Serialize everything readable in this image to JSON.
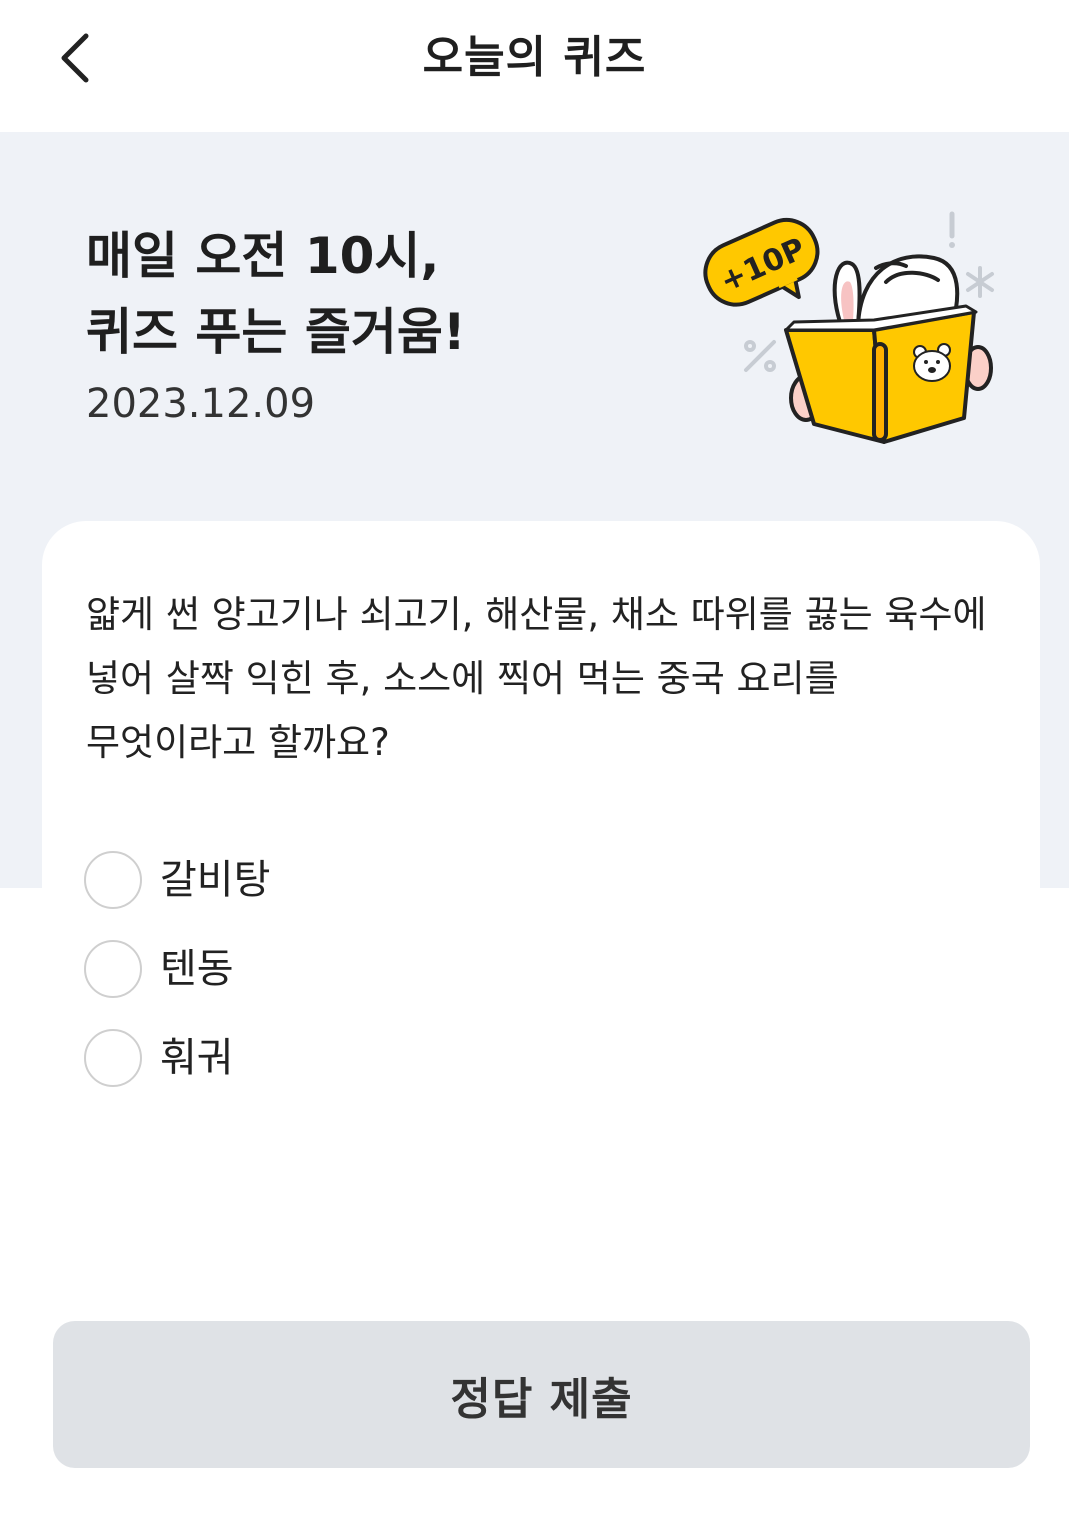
{
  "header": {
    "title": "오늘의 퀴즈",
    "back_icon": "chevron-left-icon"
  },
  "hero": {
    "title_line1": "매일 오전 10시,",
    "title_line2": "퀴즈 푸는 즐거움!",
    "date": "2023.12.09",
    "badge_text": "+10P",
    "background_color": "#eff2f7"
  },
  "quiz": {
    "question": "얇게 썬 양고기나 쇠고기, 해산물, 채소 따위를 끓는 육수에 넣어 살짝 익힌 후, 소스에 찍어 먹는 중국 요리를 무엇이라고 할까요?",
    "options": [
      {
        "label": "갈비탕",
        "selected": false
      },
      {
        "label": "텐동",
        "selected": false
      },
      {
        "label": "훠궈",
        "selected": false
      }
    ]
  },
  "submit": {
    "label": "정답 제출",
    "background_color": "#dfe2e6"
  },
  "colors": {
    "accent_yellow": "#ffc800",
    "text_primary": "#222222"
  }
}
